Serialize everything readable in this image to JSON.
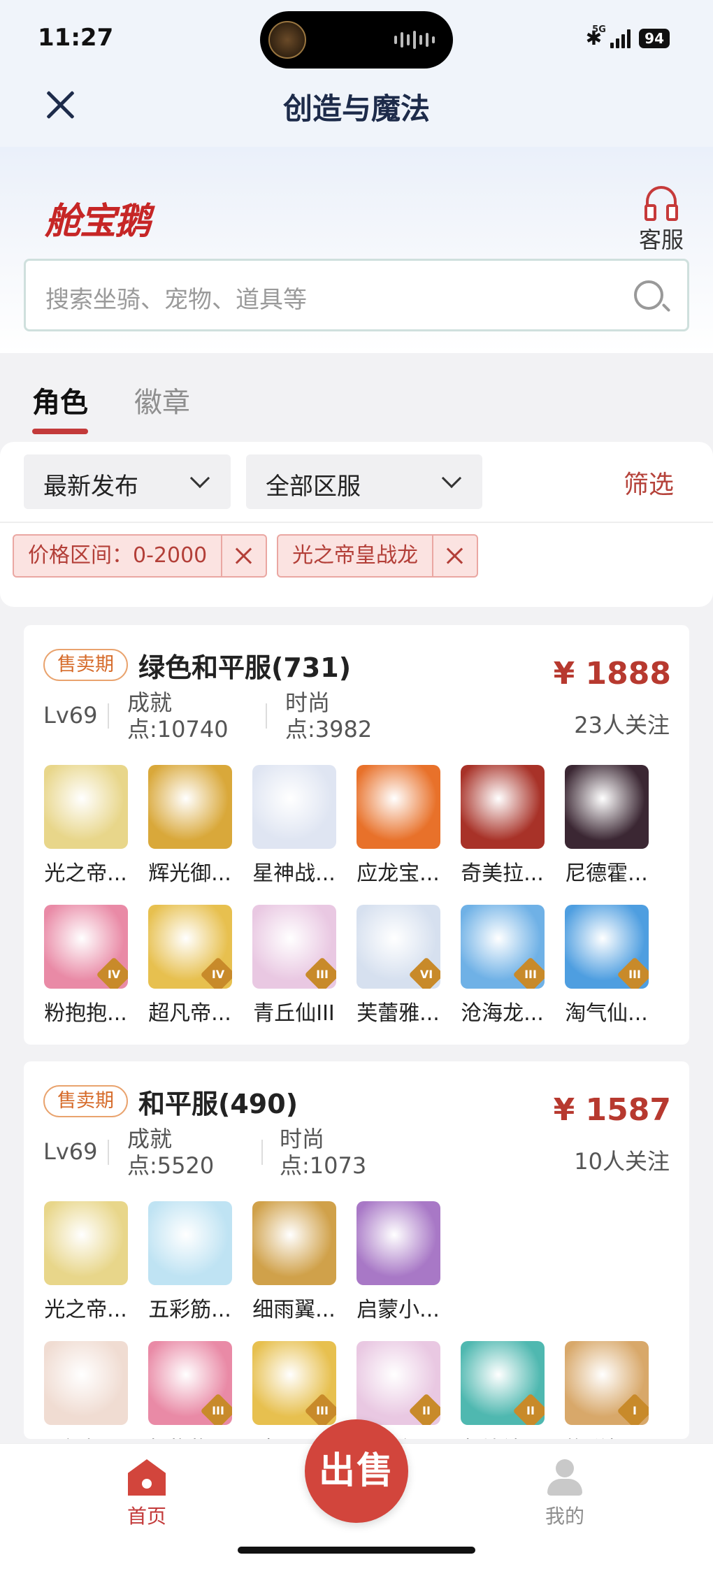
{
  "status": {
    "time": "11:27",
    "network": "5G",
    "battery": "94"
  },
  "header": {
    "title": "创造与魔法"
  },
  "brand": {
    "logo_text": "舱宝鹅",
    "service_label": "客服"
  },
  "search": {
    "placeholder": "搜索坐骑、宠物、道具等"
  },
  "tabs": [
    {
      "label": "角色",
      "active": true
    },
    {
      "label": "徽章",
      "active": false
    }
  ],
  "filters": {
    "sort": "最新发布",
    "server": "全部区服",
    "screen": "筛选",
    "chips": [
      {
        "label": "价格区间：0-2000"
      },
      {
        "label": "光之帝皇战龙"
      }
    ]
  },
  "listings": [
    {
      "badge": "售卖期",
      "name": "绿色和平服(731)",
      "price": "¥ 1888",
      "followers": "23人关注",
      "level": "Lv69",
      "stat1": [
        "成就",
        "点:10740"
      ],
      "stat2": [
        "时尚",
        "点:3982"
      ],
      "items": [
        {
          "label": "光之帝...",
          "icon": "gold-dragon",
          "color": "#e8d68a",
          "roman": ""
        },
        {
          "label": "辉光御...",
          "icon": "golden-shrine",
          "color": "#d9a83a",
          "roman": ""
        },
        {
          "label": "星神战...",
          "icon": "white-dragon",
          "color": "#dfe5f2",
          "roman": ""
        },
        {
          "label": "应龙宝...",
          "icon": "fire-dragon",
          "color": "#e8712a",
          "roman": ""
        },
        {
          "label": "奇美拉...",
          "icon": "chimera",
          "color": "#a83228",
          "roman": ""
        },
        {
          "label": "尼德霍...",
          "icon": "dark-dragon",
          "color": "#3b2733",
          "roman": ""
        },
        {
          "label": "粉抱抱...",
          "icon": "pink-bear",
          "color": "#e98aa6",
          "roman": "IV"
        },
        {
          "label": "超凡帝...",
          "icon": "gold-armor",
          "color": "#e7c04f",
          "roman": "IV"
        },
        {
          "label": "青丘仙III",
          "icon": "fox-girl",
          "color": "#e9c8e2",
          "roman": "III"
        },
        {
          "label": "芙蕾雅...",
          "icon": "goddess",
          "color": "#d6e0ef",
          "roman": "VI"
        },
        {
          "label": "沧海龙...",
          "icon": "sea-dragon",
          "color": "#6fb1e6",
          "roman": "III"
        },
        {
          "label": "淘气仙...",
          "icon": "blue-dog",
          "color": "#4e9ee0",
          "roman": "III"
        }
      ]
    },
    {
      "badge": "售卖期",
      "name": "和平服(490)",
      "price": "¥ 1587",
      "followers": "10人关注",
      "level": "Lv69",
      "stat1": [
        "成就",
        "点:5520"
      ],
      "stat2": [
        "时尚",
        "点:1073"
      ],
      "items": [
        {
          "label": "光之帝...",
          "icon": "gold-dragon",
          "color": "#e8d68a",
          "roman": ""
        },
        {
          "label": "五彩筋...",
          "icon": "cloud",
          "color": "#bfe3f3",
          "roman": ""
        },
        {
          "label": "细雨翼...",
          "icon": "bird",
          "color": "#d0a14a",
          "roman": ""
        },
        {
          "label": "启蒙小...",
          "icon": "white-deer",
          "color": "#a878c6",
          "roman": ""
        },
        {
          "label": "琉璃...",
          "icon": "lady",
          "color": "#f0dcd2",
          "roman": ""
        },
        {
          "label": "粉抱抱...",
          "icon": "pink-bear",
          "color": "#e98aa6",
          "roman": "III"
        },
        {
          "label": "超凡...",
          "icon": "gold-armor",
          "color": "#e7c04f",
          "roman": "III"
        },
        {
          "label": "青丘仙III",
          "icon": "fox-girl",
          "color": "#e9c8e2",
          "roman": "II"
        },
        {
          "label": "归墟鲨...",
          "icon": "teal-dragon",
          "color": "#4fb8b0",
          "roman": "II"
        },
        {
          "label": "炸弹松...",
          "icon": "squirrel",
          "color": "#d8a86a",
          "roman": "I"
        }
      ]
    }
  ],
  "tabbar": {
    "home": "首页",
    "sell": "出售",
    "me": "我的"
  },
  "colors": {
    "accent": "#c33a3a",
    "price": "#b7392f",
    "badge": "#d66b2a"
  }
}
